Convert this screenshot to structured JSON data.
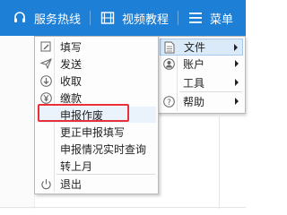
{
  "topbar": {
    "service_label": "服务热线",
    "video_label": "视频教程",
    "menu_label": "菜单",
    "bg_color": "#1e7fd6"
  },
  "main_menu": {
    "items": [
      {
        "label": "文件",
        "icon": "file-icon",
        "has_submenu": true,
        "active": true
      },
      {
        "label": "账户",
        "icon": "user-icon",
        "has_submenu": true
      },
      {
        "label": "工具",
        "icon": "",
        "has_submenu": true
      },
      {
        "label": "帮助",
        "icon": "help-icon",
        "has_submenu": true
      }
    ]
  },
  "file_submenu": {
    "items": [
      {
        "label": "填写",
        "icon": "edit-icon"
      },
      {
        "label": "发送",
        "icon": "send-icon"
      },
      {
        "label": "收取",
        "icon": "download-icon"
      },
      {
        "label": "缴款",
        "icon": "yen-icon"
      },
      {
        "label": "申报作废",
        "icon": "",
        "highlighted": true
      },
      {
        "label": "更正申报填写",
        "icon": ""
      },
      {
        "label": "申报情况实时查询",
        "icon": ""
      },
      {
        "label": "转上月",
        "icon": ""
      },
      {
        "label": "退出",
        "icon": "power-icon"
      }
    ],
    "highlight_color": "#e8303a"
  }
}
